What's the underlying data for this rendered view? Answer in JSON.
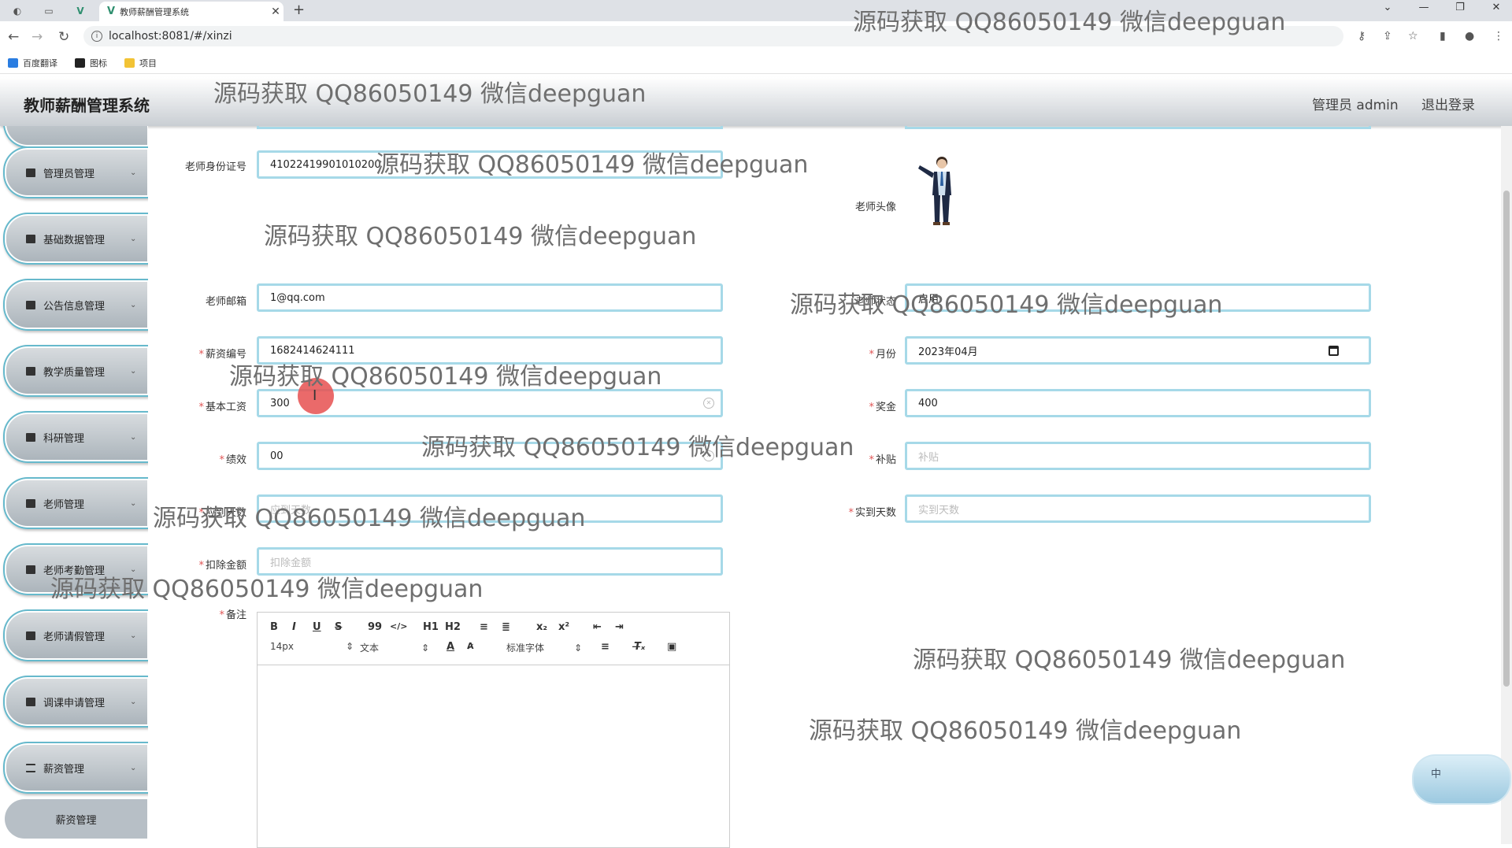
{
  "browser": {
    "tab_title": "教师薪酬管理系统",
    "url": "localhost:8081/#/xinzi",
    "bookmarks": [
      "百度翻译",
      "图标",
      "项目"
    ]
  },
  "header": {
    "app_title": "教师薪酬管理系统",
    "admin_label": "管理员 admin",
    "logout_label": "退出登录"
  },
  "sidebar": {
    "items": [
      {
        "label": "管理员管理"
      },
      {
        "label": "基础数据管理"
      },
      {
        "label": "公告信息管理"
      },
      {
        "label": "教学质量管理"
      },
      {
        "label": "科研管理"
      },
      {
        "label": "老师管理"
      },
      {
        "label": "老师考勤管理"
      },
      {
        "label": "老师请假管理"
      },
      {
        "label": "调课申请管理"
      },
      {
        "label": "薪资管理"
      }
    ],
    "submenu": {
      "label": "薪资管理"
    }
  },
  "form": {
    "id_card": {
      "label": "老师身份证号",
      "value": "41022419901010200"
    },
    "avatar": {
      "label": "老师头像"
    },
    "email": {
      "label": "老师邮箱",
      "value": "1@qq.com"
    },
    "status": {
      "label": "老师状态",
      "value": "启用"
    },
    "salary_no": {
      "label": "薪资编号",
      "value": "1682414624111"
    },
    "month": {
      "label": "月份",
      "value": "2023年04月"
    },
    "base_salary": {
      "label": "基本工资",
      "value": "300"
    },
    "bonus": {
      "label": "奖金",
      "value": "400"
    },
    "performance": {
      "label": "绩效",
      "value": "00"
    },
    "subsidy": {
      "label": "补贴",
      "placeholder": "补贴"
    },
    "due_days": {
      "label": "应到天数",
      "placeholder": "应到天数"
    },
    "actual_days": {
      "label": "实到天数",
      "placeholder": "实到天数"
    },
    "deduction": {
      "label": "扣除金额",
      "placeholder": "扣除金额"
    },
    "remark": {
      "label": "备注"
    }
  },
  "editor": {
    "size_select": "14px",
    "header_select": "文本",
    "font_select": "标准字体",
    "buttons": [
      "B",
      "I",
      "U",
      "S",
      "99",
      "</>",
      "H1",
      "H2",
      "≡",
      "≣",
      "x₂",
      "x²",
      "⇤",
      "⇥"
    ]
  },
  "float_widget": {
    "label": "中"
  },
  "watermark": "源码获取 QQ86050149 微信deepguan"
}
